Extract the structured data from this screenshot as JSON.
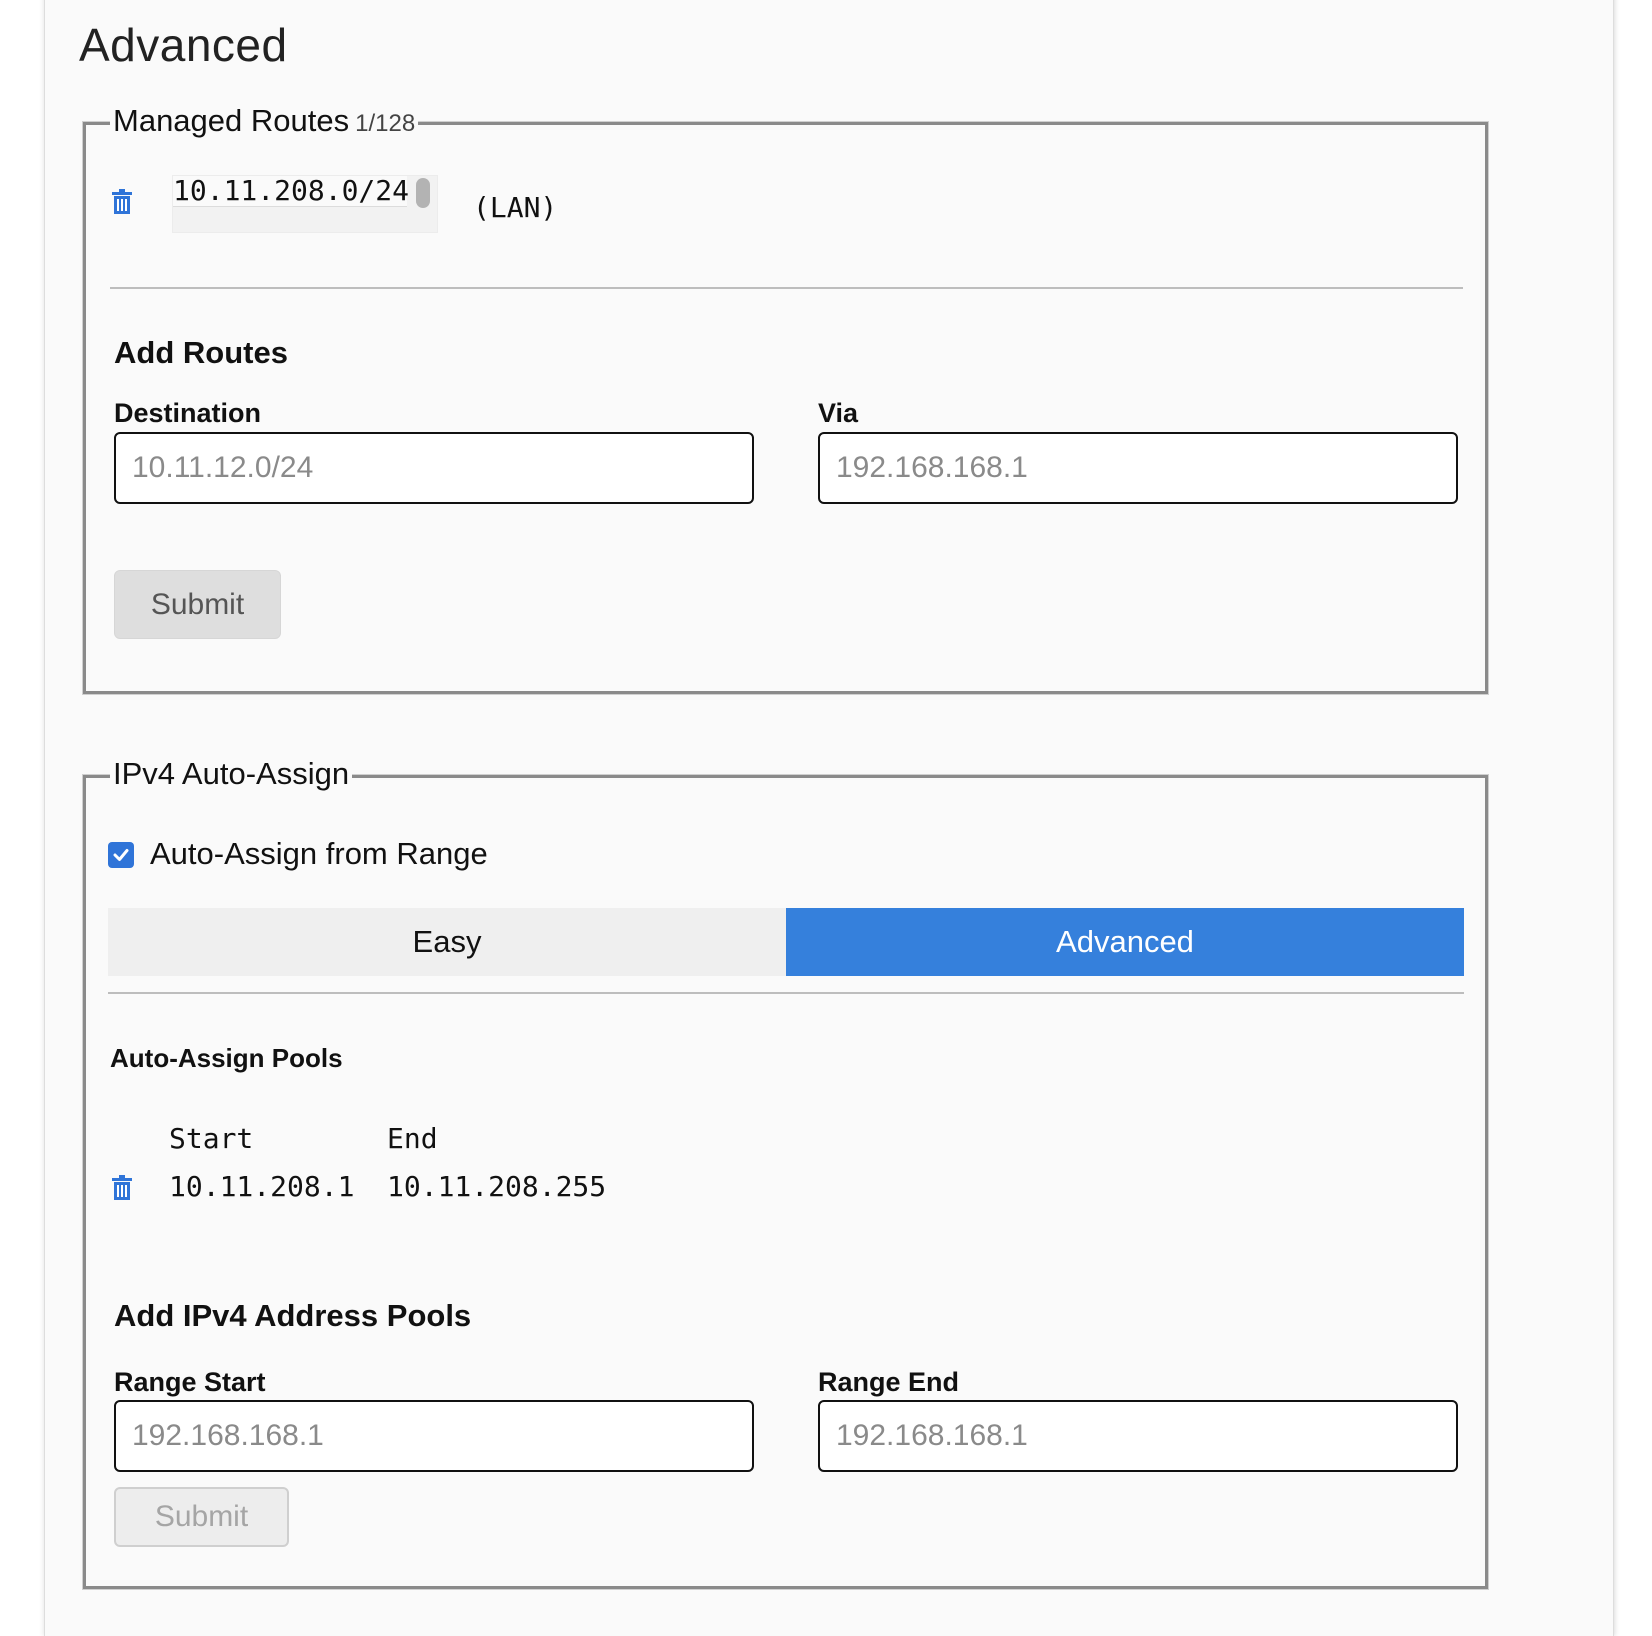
{
  "page": {
    "title": "Advanced"
  },
  "managed_routes": {
    "legend": "Managed Routes",
    "count": "1/128",
    "routes": [
      {
        "destination": "10.11.208.0/24",
        "via_label": "(LAN)"
      }
    ],
    "add": {
      "title": "Add Routes",
      "destination_label": "Destination",
      "destination_placeholder": "10.11.12.0/24",
      "via_label": "Via",
      "via_placeholder": "192.168.168.1",
      "submit_label": "Submit"
    }
  },
  "ipv4_auto_assign": {
    "legend": "IPv4 Auto-Assign",
    "checkbox_label": "Auto-Assign from Range",
    "checkbox_checked": true,
    "tabs": [
      {
        "label": "Easy",
        "active": false
      },
      {
        "label": "Advanced",
        "active": true
      }
    ],
    "pools": {
      "title": "Auto-Assign Pools",
      "columns": [
        "Start",
        "End"
      ],
      "rows": [
        {
          "start": "10.11.208.1",
          "end": "10.11.208.255"
        }
      ]
    },
    "add": {
      "title": "Add IPv4 Address Pools",
      "range_start_label": "Range Start",
      "range_start_placeholder": "192.168.168.1",
      "range_end_label": "Range End",
      "range_end_placeholder": "192.168.168.1",
      "submit_label": "Submit"
    }
  },
  "colors": {
    "accent": "#3580dc",
    "trash_icon": "#2f74d8",
    "border": "#8a8a8a"
  },
  "icons": {
    "delete": "trash-icon",
    "checkbox": "checkmark-icon"
  }
}
